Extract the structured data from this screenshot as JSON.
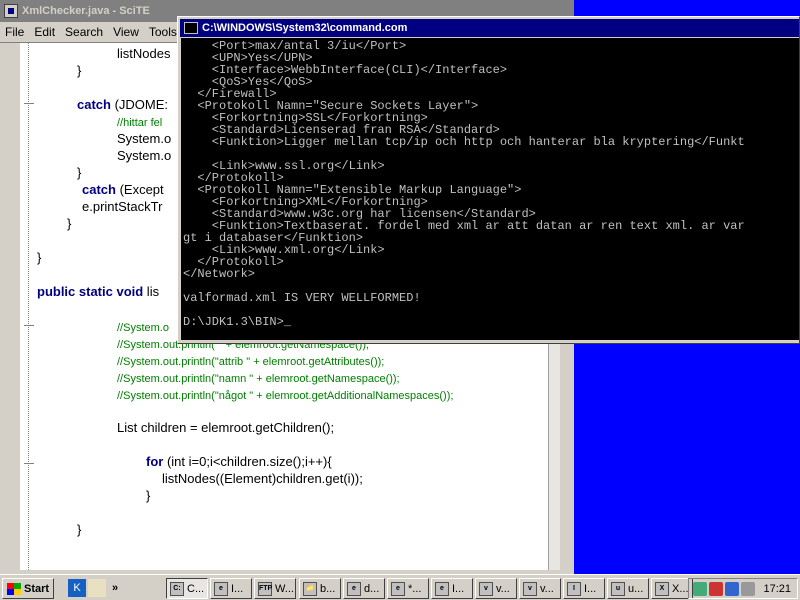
{
  "scite": {
    "title": "XmlChecker.java - SciTE",
    "menu": [
      "File",
      "Edit",
      "Search",
      "View",
      "Tools"
    ],
    "code": [
      {
        "text": "listNodes",
        "cls": ""
      },
      {
        "text": "}",
        "cls": ""
      },
      {
        "text": "catch",
        "cls": "kw",
        "rest": " (JDOME:"
      },
      {
        "text": "//hittar fel",
        "cls": "cm"
      },
      {
        "text": "System.o",
        "cls": ""
      },
      {
        "text": "System.o",
        "cls": ""
      },
      {
        "text": "}",
        "cls": ""
      },
      {
        "text": "catch",
        "cls": "kw",
        "rest": " (Except"
      },
      {
        "text": "e.printStackTr",
        "cls": ""
      },
      {
        "text": "}",
        "cls": ""
      },
      {
        "text": "}",
        "cls": ""
      },
      {
        "text": "public static void",
        "cls": "kw",
        "rest": " lis"
      },
      {
        "text": "//System.o",
        "cls": "cm"
      },
      {
        "text": "//System.out.println(\"\" + elemroot.getNamespace());",
        "cls": "cm"
      },
      {
        "text": "//System.out.println(\"attrib \" + elemroot.getAttributes());",
        "cls": "cm"
      },
      {
        "text": "//System.out.println(\"namn \" + elemroot.getNamespace());",
        "cls": "cm"
      },
      {
        "text": "//System.out.println(\"något \" + elemroot.getAdditionalNamespaces());",
        "cls": "cm"
      },
      {
        "text": "List children = elemroot.getChildren();",
        "cls": ""
      },
      {
        "text": "for",
        "cls": "kw",
        "rest": " (int i=0;i<children.size();i++){"
      },
      {
        "text": "listNodes((Element)children.get(i));",
        "cls": ""
      },
      {
        "text": "}",
        "cls": ""
      },
      {
        "text": "}",
        "cls": ""
      }
    ]
  },
  "console": {
    "title": "C:\\WINDOWS\\System32\\command.com",
    "lines": [
      "    <Port>max/antal 3/iu</Port>",
      "    <UPN>Yes</UPN>",
      "    <Interface>WebbInterface(CLI)</Interface>",
      "    <QoS>Yes</QoS>",
      "  </Firewall>",
      "  <Protokoll Namn=\"Secure Sockets Layer\">",
      "    <Forkortning>SSL</Forkortning>",
      "    <Standard>Licenserad fran RSA</Standard>",
      "    <Funktion>Ligger mellan tcp/ip och http och hanterar bla kryptering</Funkt",
      "",
      "    <Link>www.ssl.org</Link>",
      "  </Protokoll>",
      "  <Protokoll Namn=\"Extensible Markup Language\">",
      "    <Forkortning>XML</Forkortning>",
      "    <Standard>www.w3c.org har licensen</Standard>",
      "    <Funktion>Textbaserat. fordel med xml ar att datan ar ren text xml. ar var",
      "gt i databaser</Funktion>",
      "    <Link>www.xml.org</Link>",
      "  </Protokoll>",
      "</Network>",
      "",
      "valformad.xml IS VERY WELLFORMED!",
      "",
      "D:\\JDK1.3\\BIN>_"
    ]
  },
  "taskbar": {
    "start_label": "Start",
    "tasks": [
      {
        "icon": "C:",
        "label": "C..."
      },
      {
        "icon": "e",
        "label": "I..."
      },
      {
        "icon": "FTP",
        "label": "W..."
      },
      {
        "icon": "📁",
        "label": "b..."
      },
      {
        "icon": "e",
        "label": "d..."
      },
      {
        "icon": "e",
        "label": "*..."
      },
      {
        "icon": "e",
        "label": "I..."
      },
      {
        "icon": "v",
        "label": "v..."
      },
      {
        "icon": "v",
        "label": "v..."
      },
      {
        "icon": "I",
        "label": "I..."
      },
      {
        "icon": "u",
        "label": "u..."
      },
      {
        "icon": "X",
        "label": "X..."
      }
    ],
    "clock": "17:21"
  }
}
